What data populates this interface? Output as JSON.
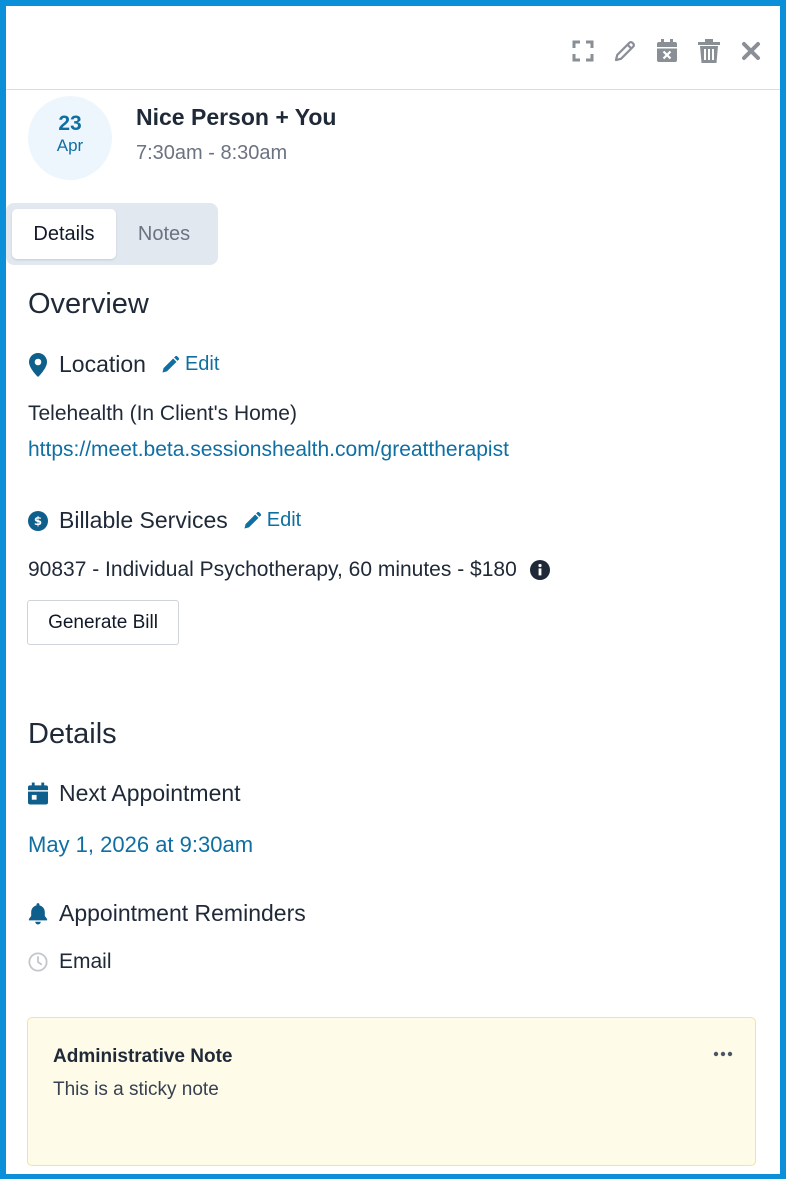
{
  "toolbar": {
    "icons": [
      "expand-icon",
      "pencil-icon",
      "calendar-x-icon",
      "trash-icon",
      "close-icon"
    ]
  },
  "appointment": {
    "day": "23",
    "month": "Apr",
    "title": "Nice Person + You",
    "time": "7:30am - 8:30am"
  },
  "tabs": [
    {
      "label": "Details",
      "active": true
    },
    {
      "label": "Notes",
      "active": false
    }
  ],
  "overview": {
    "heading": "Overview",
    "location": {
      "label": "Location",
      "edit_label": "Edit",
      "type": "Telehealth (In Client's Home)",
      "url": "https://meet.beta.sessionshealth.com/greattherapist"
    },
    "billing": {
      "label": "Billable Services",
      "edit_label": "Edit",
      "service": "90837 - Individual Psychotherapy, 60 minutes - $180",
      "generate_label": "Generate Bill"
    }
  },
  "details": {
    "heading": "Details",
    "next_appointment": {
      "label": "Next Appointment",
      "value": "May 1, 2026 at 9:30am"
    },
    "reminders": {
      "label": "Appointment Reminders",
      "method": "Email"
    }
  },
  "note": {
    "title": "Administrative Note",
    "text": "This is a sticky note"
  },
  "colors": {
    "accent": "#0f6fa3",
    "frame": "#0a8fd8",
    "note_bg": "#fefbe9",
    "icon_gray": "#8a8f96"
  }
}
